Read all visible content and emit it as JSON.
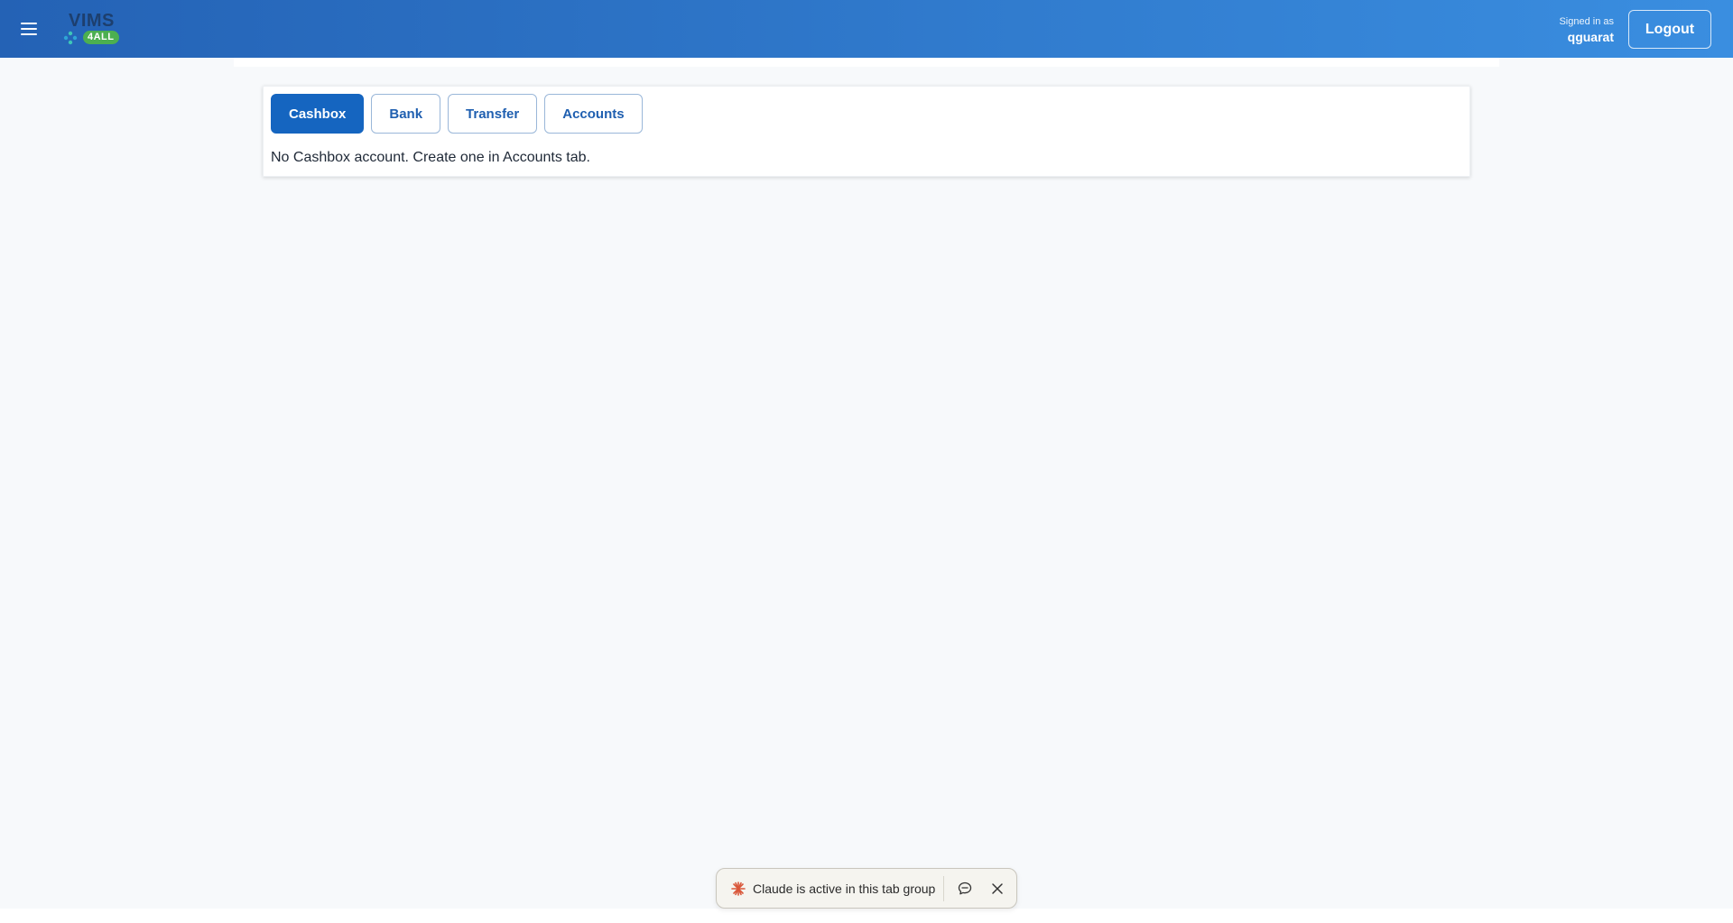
{
  "header": {
    "logo_text": "VIMS",
    "logo_badge": "4ALL",
    "signed_in_label": "Signed in as",
    "username": "qguarat",
    "logout_label": "Logout"
  },
  "tabs": [
    {
      "label": "Cashbox",
      "active": true
    },
    {
      "label": "Bank",
      "active": false
    },
    {
      "label": "Transfer",
      "active": false
    },
    {
      "label": "Accounts",
      "active": false
    }
  ],
  "message": "No Cashbox account. Create one in Accounts tab.",
  "claude_bar": {
    "text": "Claude is active in this tab group",
    "icons": [
      "claude-star-icon",
      "chat-icon",
      "close-icon"
    ]
  },
  "colors": {
    "header_start": "#2462b5",
    "header_end": "#3a8ee0",
    "tab_active": "#1565c0",
    "tab_text": "#1f5fb0",
    "logo_badge": "#4caf50"
  }
}
